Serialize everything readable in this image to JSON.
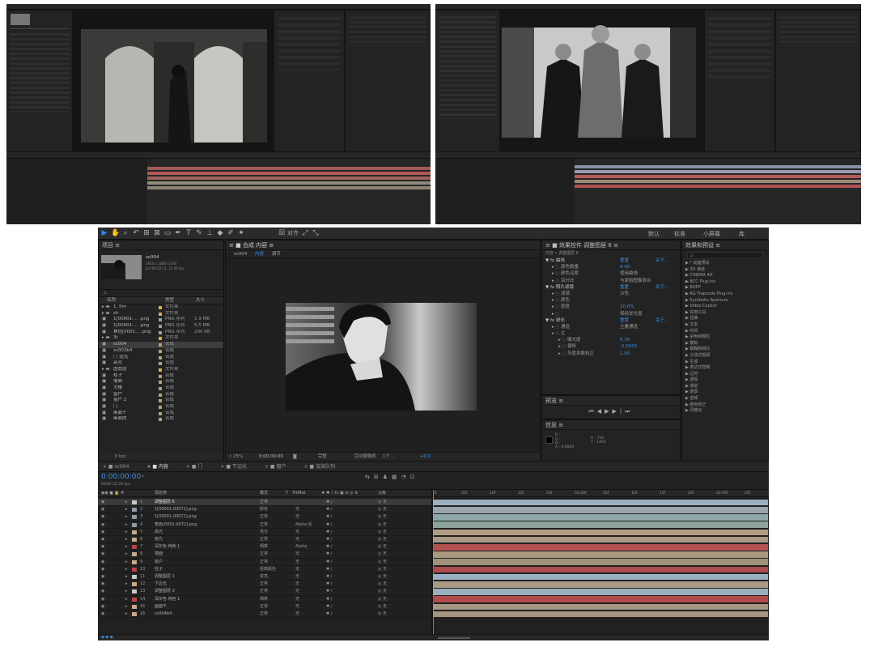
{
  "screens": {
    "top_left": {
      "label": "After Effects screenshot 1"
    },
    "top_right": {
      "label": "After Effects screenshot 2"
    }
  },
  "toolbar": {
    "workspaces": [
      "默认",
      "标准",
      "小屏幕",
      "库"
    ],
    "snap_label": "对齐"
  },
  "project": {
    "title": "项目",
    "comp_name": "sc004",
    "comp_info": "1920 x 1080 (1.00)",
    "comp_duration": "Δ 0:00:02:21, 25.00 fps",
    "search_placeholder": "ρ.",
    "col_name": "名称",
    "col_type": "类型",
    "col_size": "大小",
    "items": [
      {
        "name": "1. 5m",
        "type": "文件夹",
        "size": ""
      },
      {
        "name": "sh",
        "type": "文件夹",
        "size": ""
      },
      {
        "name": "1[00001-... .png",
        "type": "PNG 序列",
        "size": "1.9 MB"
      },
      {
        "name": "1[00001-... .png",
        "type": "PNG 序列",
        "size": "5.5 MB"
      },
      {
        "name": "角色[0001... .png",
        "type": "PNG 序列",
        "size": "200 KB"
      },
      {
        "name": "3t",
        "type": "文件夹",
        "size": ""
      },
      {
        "name": "sc004",
        "type": "合成",
        "size": ""
      },
      {
        "name": "sc003b4",
        "type": "合成",
        "size": ""
      },
      {
        "name": "门 边光",
        "type": "合成",
        "size": ""
      },
      {
        "name": "高光",
        "type": "合成",
        "size": ""
      },
      {
        "name": "固态层",
        "type": "文件夹",
        "size": ""
      },
      {
        "name": "柱子",
        "type": "合成",
        "size": ""
      },
      {
        "name": "墙面",
        "type": "合成",
        "size": ""
      },
      {
        "name": "大楼",
        "type": "合成",
        "size": ""
      },
      {
        "name": "窗户",
        "type": "合成",
        "size": ""
      },
      {
        "name": "窗户 2",
        "type": "合成",
        "size": ""
      },
      {
        "name": "门",
        "type": "合成",
        "size": ""
      },
      {
        "name": "画面千",
        "type": "合成",
        "size": ""
      },
      {
        "name": "画面的",
        "type": "合成",
        "size": ""
      }
    ],
    "bpc": "8 bpc"
  },
  "composition": {
    "tab_label": "合成 内容",
    "breadcrumb": [
      "sc004",
      "内容",
      "调节"
    ],
    "zoom": "25%",
    "timecode": "0:00:00:00",
    "quality": "完整",
    "camera": "活动摄像机",
    "views": "1个...",
    "exposure": "+0.0"
  },
  "effects": {
    "tab_label": "效果控件 调整图层 6",
    "layer_line": "内容 • 调整图层 6",
    "rows": [
      {
        "indent": 0,
        "label": "曲线",
        "value": "重置",
        "extra": "关于..."
      },
      {
        "indent": 1,
        "label": "颜色数量",
        "value": "6.00",
        "extra": ""
      },
      {
        "indent": 1,
        "label": "颜色深度",
        "value": "使用曲线",
        "extra": ""
      },
      {
        "indent": 1,
        "label": "百分比",
        "value": "与原始图像混合",
        "extra": ""
      },
      {
        "indent": 0,
        "label": "照片滤镜",
        "value": "重置",
        "extra": "关于..."
      },
      {
        "indent": 1,
        "label": "滤镜",
        "value": "冷色",
        "extra": ""
      },
      {
        "indent": 1,
        "label": "颜色",
        "value": "",
        "extra": ""
      },
      {
        "indent": 1,
        "label": "密度",
        "value": "10.0%",
        "extra": ""
      },
      {
        "indent": 1,
        "label": "",
        "value": "保持发光度",
        "extra": ""
      },
      {
        "indent": 0,
        "label": "锐化",
        "value": "重置",
        "extra": "关于..."
      },
      {
        "indent": 1,
        "label": "通道",
        "value": "主要通道",
        "extra": ""
      },
      {
        "indent": 1,
        "label": "主",
        "value": "",
        "extra": ""
      },
      {
        "indent": 2,
        "label": "曝光度",
        "value": "0.30",
        "extra": ""
      },
      {
        "indent": 2,
        "label": "偏移",
        "value": "-0.0000",
        "extra": ""
      },
      {
        "indent": 2,
        "label": "灰度系数校正",
        "value": "1.00",
        "extra": ""
      }
    ]
  },
  "preview": {
    "title": "预览"
  },
  "info": {
    "title": "信息",
    "r": "R :",
    "g": "G :",
    "b": "B :",
    "a": "A : 0.0000",
    "x": "X : 716",
    "y": "Y : 1404"
  },
  "effects_presets": {
    "title": "效果和预设",
    "search_placeholder": "ρ.",
    "items": [
      "* 动画预设",
      "3D 通道",
      "CINEMA 4D",
      "BCC Plug-ins",
      "BOPP",
      "RG Trapcode Plug-ins",
      "Synthetic Aperture",
      "Video Copilot",
      "实用工具",
      "扭曲",
      "文本",
      "时间",
      "杂色和颗粒",
      "模拟",
      "模糊和锐化",
      "沉浸式视频",
      "生成",
      "表达式控制",
      "过时",
      "透视",
      "通道",
      "遮罩",
      "音频",
      "颜色校正",
      "风格化"
    ]
  },
  "timeline": {
    "tabs": [
      "sc004",
      "内容",
      "门",
      "下边光",
      "窗户",
      "渲染队列"
    ],
    "timecode": "0:00:00:00",
    "timecode_sub": "00000 (25.00 fps)",
    "search_placeholder": "ρ.",
    "col_name": "源名称",
    "col_mode": "模式",
    "col_trkmat": "TrkMat",
    "col_parent": "父级",
    "ruler": [
      "0f",
      "05f",
      "10f",
      "15f",
      "20f",
      "01:00f",
      "05f",
      "10f",
      "15f",
      "20f",
      "02:00f",
      "05f"
    ],
    "layers": [
      {
        "num": "1",
        "name": "调整图层 6",
        "mode": "正常",
        "trk": "",
        "parent": "无",
        "color": "#c8c8c8",
        "bar": "#9bb0c2"
      },
      {
        "num": "2",
        "name": "1[00001-00072].png",
        "mode": "颜色",
        "trk": "无",
        "parent": "无",
        "color": "#8f9aa6",
        "bar": "#9aa6ab"
      },
      {
        "num": "3",
        "name": "1[00001-00072].png",
        "mode": "正常",
        "trk": "无",
        "parent": "无",
        "color": "#8f9aa6",
        "bar": "#8ea7a9"
      },
      {
        "num": "4",
        "name": "角色[0001-0072].png",
        "mode": "正常",
        "trk": "Alpha 反",
        "parent": "无",
        "color": "#8f9aa6",
        "bar": "#8da49c"
      },
      {
        "num": "5",
        "name": "高光",
        "mode": "亮光",
        "trk": "无",
        "parent": "无",
        "color": "#c9a98a",
        "bar": "#b39d84"
      },
      {
        "num": "6",
        "name": "窗光",
        "mode": "正常",
        "trk": "无",
        "parent": "无",
        "color": "#c9a98a",
        "bar": "#a99a86"
      },
      {
        "num": "7",
        "name": "深灰色 纯色 1",
        "mode": "相乘",
        "trk": "Alpha",
        "parent": "无",
        "color": "#b84545",
        "bar": "#b45252"
      },
      {
        "num": "8",
        "name": "墙面",
        "mode": "正常",
        "trk": "无",
        "parent": "无",
        "color": "#c9a98a",
        "bar": "#a9977f"
      },
      {
        "num": "9",
        "name": "窗户",
        "mode": "正常",
        "trk": "无",
        "parent": "无",
        "color": "#c9a98a",
        "bar": "#a0927b"
      },
      {
        "num": "10",
        "name": "柱子",
        "mode": "经典颜色",
        "trk": "无",
        "parent": "无",
        "color": "#b84545",
        "bar": "#ad4d4d"
      },
      {
        "num": "11",
        "name": "调整图层 1",
        "mode": "变亮",
        "trk": "无",
        "parent": "无",
        "color": "#c8c8c8",
        "bar": "#9bb0c2"
      },
      {
        "num": "12",
        "name": "下边光",
        "mode": "正常",
        "trk": "无",
        "parent": "无",
        "color": "#c9a98a",
        "bar": "#a99a86"
      },
      {
        "num": "13",
        "name": "调整图层 3",
        "mode": "正常",
        "trk": "无",
        "parent": "无",
        "color": "#c8c8c8",
        "bar": "#9ab0bf"
      },
      {
        "num": "14",
        "name": "深灰色 纯色 1",
        "mode": "相乘",
        "trk": "无",
        "parent": "无",
        "color": "#b84545",
        "bar": "#b24c4c"
      },
      {
        "num": "15",
        "name": "画面千",
        "mode": "正常",
        "trk": "无",
        "parent": "无",
        "color": "#c9a98a",
        "bar": "#a79781"
      },
      {
        "num": "16",
        "name": "sc004b4",
        "mode": "正常",
        "trk": "无",
        "parent": "无",
        "color": "#c9a98a",
        "bar": "#a69580"
      }
    ]
  },
  "colors": {
    "accent": "#2e8af5",
    "timecode": "#3a8ee6",
    "panel_bg": "#232323"
  }
}
